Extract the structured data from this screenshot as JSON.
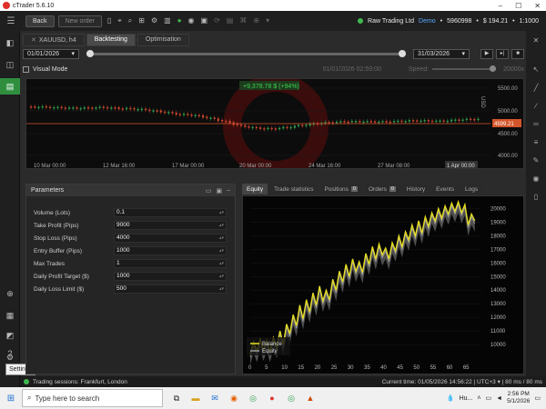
{
  "app": {
    "title": "cTrader 5.6.10"
  },
  "toolbar": {
    "back_label": "Back",
    "new_order_label": "New order",
    "icons": [
      "search-icon",
      "layout-icon",
      "crosshair-icon",
      "settings-icon",
      "eye-icon",
      "spark-icon",
      "grid-icon",
      "bell-icon",
      "image-icon",
      "code-icon",
      "globe-icon",
      "dropdown-icon"
    ]
  },
  "account": {
    "broker": "Raw Trading Ltd",
    "type": "Demo",
    "number": "5960998",
    "balance": "$ 194.21",
    "leverage": "1:1000"
  },
  "tabs": [
    {
      "label": "XAUUSD, h4"
    },
    {
      "label": "Backtesting"
    },
    {
      "label": "Optimisation"
    }
  ],
  "backtest": {
    "start_date": "01/01/2026",
    "end_date": "31/03/2026",
    "visual_mode_label": "Visual Mode",
    "visual_time": "01/01/2026 02:59:00",
    "speed_label": "Speed:",
    "speed_value": "20000x"
  },
  "price_chart": {
    "badge": "+9,378.78 $ (+94%)",
    "y_ticks": [
      "5500.00",
      "5000.00",
      "4500.00",
      "4000.00"
    ],
    "x_ticks": [
      "10 Mar 00:00",
      "12 Mar 16:00",
      "17 Mar 00:00",
      "20 Mar 00:00",
      "24 Mar 16:00",
      "27 Mar 08:00",
      "1 Apr 00:00"
    ],
    "current_price": "4599.21",
    "axis_label": "USD"
  },
  "parameters": {
    "title": "Parameters",
    "rows": [
      {
        "label": "Volume (Lots)",
        "value": "0.1"
      },
      {
        "label": "Take Profit (Pips)",
        "value": "9000"
      },
      {
        "label": "Stop Loss (Pips)",
        "value": "4000"
      },
      {
        "label": "Entry Buffer (Pips)",
        "value": "1000"
      },
      {
        "label": "Max Trades",
        "value": "1"
      },
      {
        "label": "Daily Profit Target ($)",
        "value": "1000"
      },
      {
        "label": "Daily Loss Limit ($)",
        "value": "500"
      }
    ]
  },
  "results_tabs": [
    {
      "label": "Equity",
      "count": ""
    },
    {
      "label": "Trade statistics",
      "count": ""
    },
    {
      "label": "Positions",
      "count": "0"
    },
    {
      "label": "Orders",
      "count": "0"
    },
    {
      "label": "History",
      "count": ""
    },
    {
      "label": "Events",
      "count": ""
    },
    {
      "label": "Logs",
      "count": ""
    }
  ],
  "chart_data": {
    "type": "line",
    "x_ticks": [
      0,
      5,
      10,
      15,
      20,
      25,
      30,
      35,
      40,
      45,
      50,
      55,
      60,
      65
    ],
    "y_ticks": [
      10000,
      11000,
      12000,
      13000,
      14000,
      15000,
      16000,
      17000,
      18000,
      19000,
      20000
    ],
    "xlim": [
      0,
      70
    ],
    "ylim": [
      9000,
      20500
    ],
    "legend": [
      "Balance",
      "Equity"
    ],
    "legend_position": "bottom-left",
    "series": [
      {
        "name": "Balance",
        "color": "#e8e020",
        "x": [
          0,
          1,
          2,
          3,
          4,
          5,
          6,
          7,
          8,
          9,
          10,
          11,
          12,
          13,
          14,
          15,
          16,
          17,
          18,
          19,
          20,
          21,
          22,
          23,
          24,
          25,
          26,
          27,
          28,
          29,
          30,
          31,
          32,
          33,
          34,
          35,
          36,
          37,
          38,
          39,
          40,
          41,
          42,
          43,
          44,
          45,
          46,
          47,
          48,
          49,
          50,
          51,
          52,
          53,
          54,
          55,
          56,
          57,
          58,
          59,
          60,
          61,
          62,
          63,
          64,
          65,
          66,
          67,
          68
        ],
        "values": [
          9300,
          10200,
          9500,
          10400,
          9600,
          10300,
          9500,
          10500,
          9800,
          11000,
          10000,
          11500,
          10800,
          12200,
          11400,
          12900,
          11900,
          13300,
          12400,
          13800,
          12900,
          14300,
          13200,
          14000,
          13300,
          14800,
          14000,
          15400,
          14600,
          15900,
          15000,
          16300,
          15400,
          16100,
          15300,
          16700,
          15900,
          17200,
          16300,
          17400,
          16600,
          17100,
          16300,
          17500,
          16900,
          18000,
          17200,
          18300,
          17700,
          18800,
          18000,
          19100,
          18200,
          19400,
          18700,
          19700,
          19100,
          20000,
          19300,
          20200,
          19600,
          20400,
          19800,
          20500,
          19700,
          20300,
          18800,
          19600,
          19100
        ]
      },
      {
        "name": "Equity",
        "color": "#9a9a9a",
        "x": [
          0,
          1,
          2,
          3,
          4,
          5,
          6,
          7,
          8,
          9,
          10,
          11,
          12,
          13,
          14,
          15,
          16,
          17,
          18,
          19,
          20,
          21,
          22,
          23,
          24,
          25,
          26,
          27,
          28,
          29,
          30,
          31,
          32,
          33,
          34,
          35,
          36,
          37,
          38,
          39,
          40,
          41,
          42,
          43,
          44,
          45,
          46,
          47,
          48,
          49,
          50,
          51,
          52,
          53,
          54,
          55,
          56,
          57,
          58,
          59,
          60,
          61,
          62,
          63,
          64,
          65,
          66,
          67,
          68
        ],
        "values": [
          9100,
          10000,
          9300,
          10200,
          9400,
          10100,
          9300,
          10300,
          9600,
          10800,
          9800,
          11300,
          10600,
          12000,
          11200,
          12700,
          11700,
          13100,
          12200,
          13600,
          12700,
          14100,
          13000,
          13800,
          13100,
          14600,
          13800,
          15200,
          14400,
          15700,
          14800,
          16100,
          15200,
          15900,
          15100,
          16500,
          15700,
          17000,
          16100,
          17200,
          16400,
          16900,
          16100,
          17300,
          16700,
          17800,
          17000,
          18100,
          17500,
          18600,
          17800,
          18900,
          18000,
          19200,
          18500,
          19500,
          18900,
          19800,
          19100,
          20000,
          19400,
          20200,
          19600,
          20300,
          19500,
          20100,
          18600,
          19400,
          18900
        ]
      }
    ]
  },
  "statusbar": {
    "sessions": "Trading sessions: Frankfurt, London",
    "current_time": "Current time: 01/05/2026 14:56:22 | UTC+3 ▾ | 80 ms / 80 ms"
  },
  "leftbar": {
    "tooltip": "Settings"
  },
  "taskbar": {
    "search_placeholder": "Type here to search",
    "weather": "Hu...",
    "time": "2:56 PM",
    "date": "5/1/2026"
  }
}
